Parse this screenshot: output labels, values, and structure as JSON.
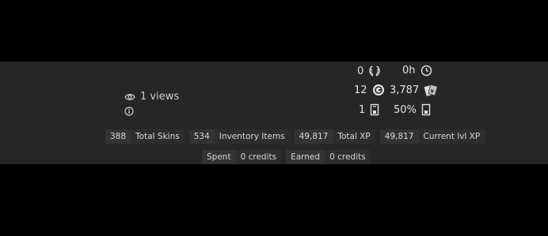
{
  "profile": {
    "views": "1 views"
  },
  "stats": {
    "laurel": {
      "value": "0",
      "icon": "laurel-icon"
    },
    "time": {
      "value": "0h",
      "icon": "clock-icon"
    },
    "coin": {
      "value": "12",
      "icon": "coin-icon"
    },
    "cards": {
      "value": "3,787",
      "icon": "cards-icon"
    },
    "door": {
      "value": "1",
      "icon": "door-icon"
    },
    "door_percent": {
      "value": "50%",
      "icon": "door-icon"
    }
  },
  "chips": [
    {
      "value": "388",
      "label": "Total Skins"
    },
    {
      "value": "534",
      "label": "Inventory Items"
    },
    {
      "value": "49,817",
      "label": "Total XP"
    },
    {
      "value": "49,817",
      "label": "Current lvl XP"
    }
  ],
  "credits": [
    {
      "label": "Spent",
      "value": "0 credits"
    },
    {
      "label": "Earned",
      "value": "0 credits"
    }
  ],
  "colors": {
    "background": "#000000",
    "panel": "#262626",
    "chip": "#333333",
    "text": "#d6d6d6"
  }
}
